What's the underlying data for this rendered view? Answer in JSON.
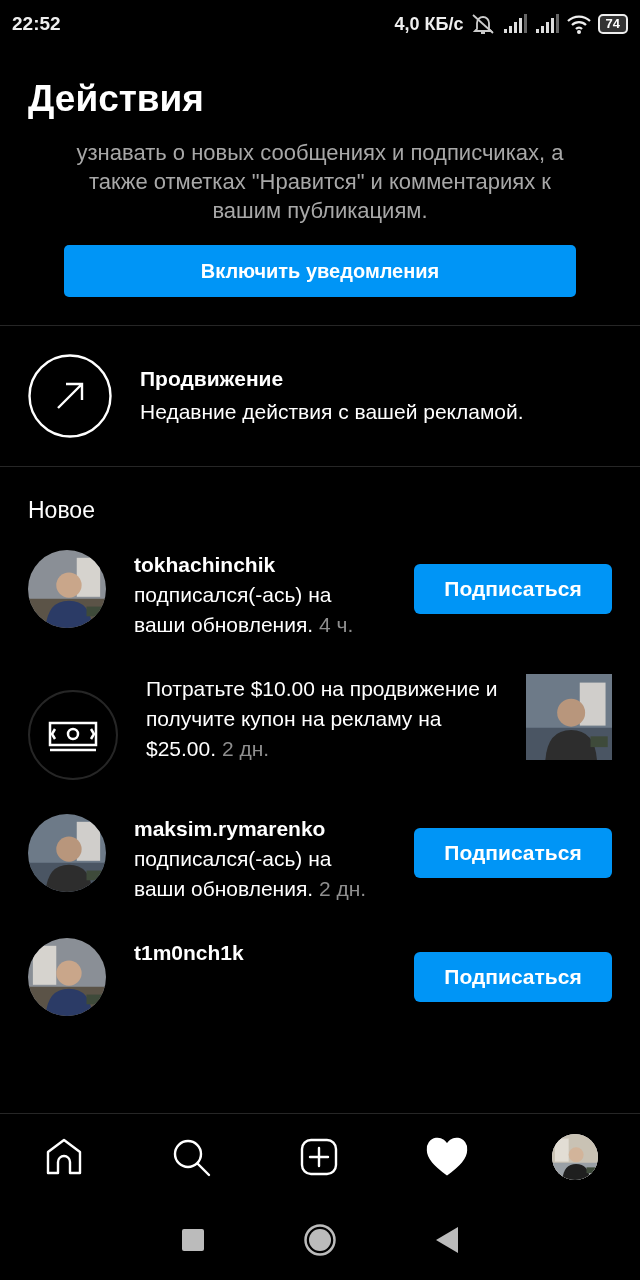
{
  "status_bar": {
    "time": "22:52",
    "speed": "4,0 КБ/с",
    "battery": "74"
  },
  "header": {
    "title": "Действия"
  },
  "notifications_prompt": {
    "text": "узнавать о новых сообщениях и подписчиках, а также отметках \"Нравится\" и комментариях к вашим публикациям.",
    "button": "Включить уведомления"
  },
  "promotion": {
    "title": "Продвижение",
    "subtitle": "Недавние действия с вашей рекламой."
  },
  "section_title": "Новое",
  "activity": [
    {
      "kind": "follow",
      "username": "tokhachinchik",
      "text": "подписался(-ась) на ваши обновления.",
      "time": "4 ч.",
      "button": "Подписаться"
    },
    {
      "kind": "promo",
      "text": "Потратьте $10.00 на продвижение и получите купон на рекламу на $25.00.",
      "time": "2 дн."
    },
    {
      "kind": "follow",
      "username": "maksim.rymarenko",
      "text": "подписался(-ась) на ваши обновления.",
      "time": "2 дн.",
      "button": "Подписаться"
    },
    {
      "kind": "follow",
      "username": "t1m0nch1k",
      "button": "Подписаться"
    }
  ],
  "bottom_nav": [
    {
      "kind": "home",
      "selected": false
    },
    {
      "kind": "search",
      "selected": false
    },
    {
      "kind": "add",
      "selected": false
    },
    {
      "kind": "heart",
      "selected": true
    },
    {
      "kind": "profile",
      "selected": false
    }
  ]
}
